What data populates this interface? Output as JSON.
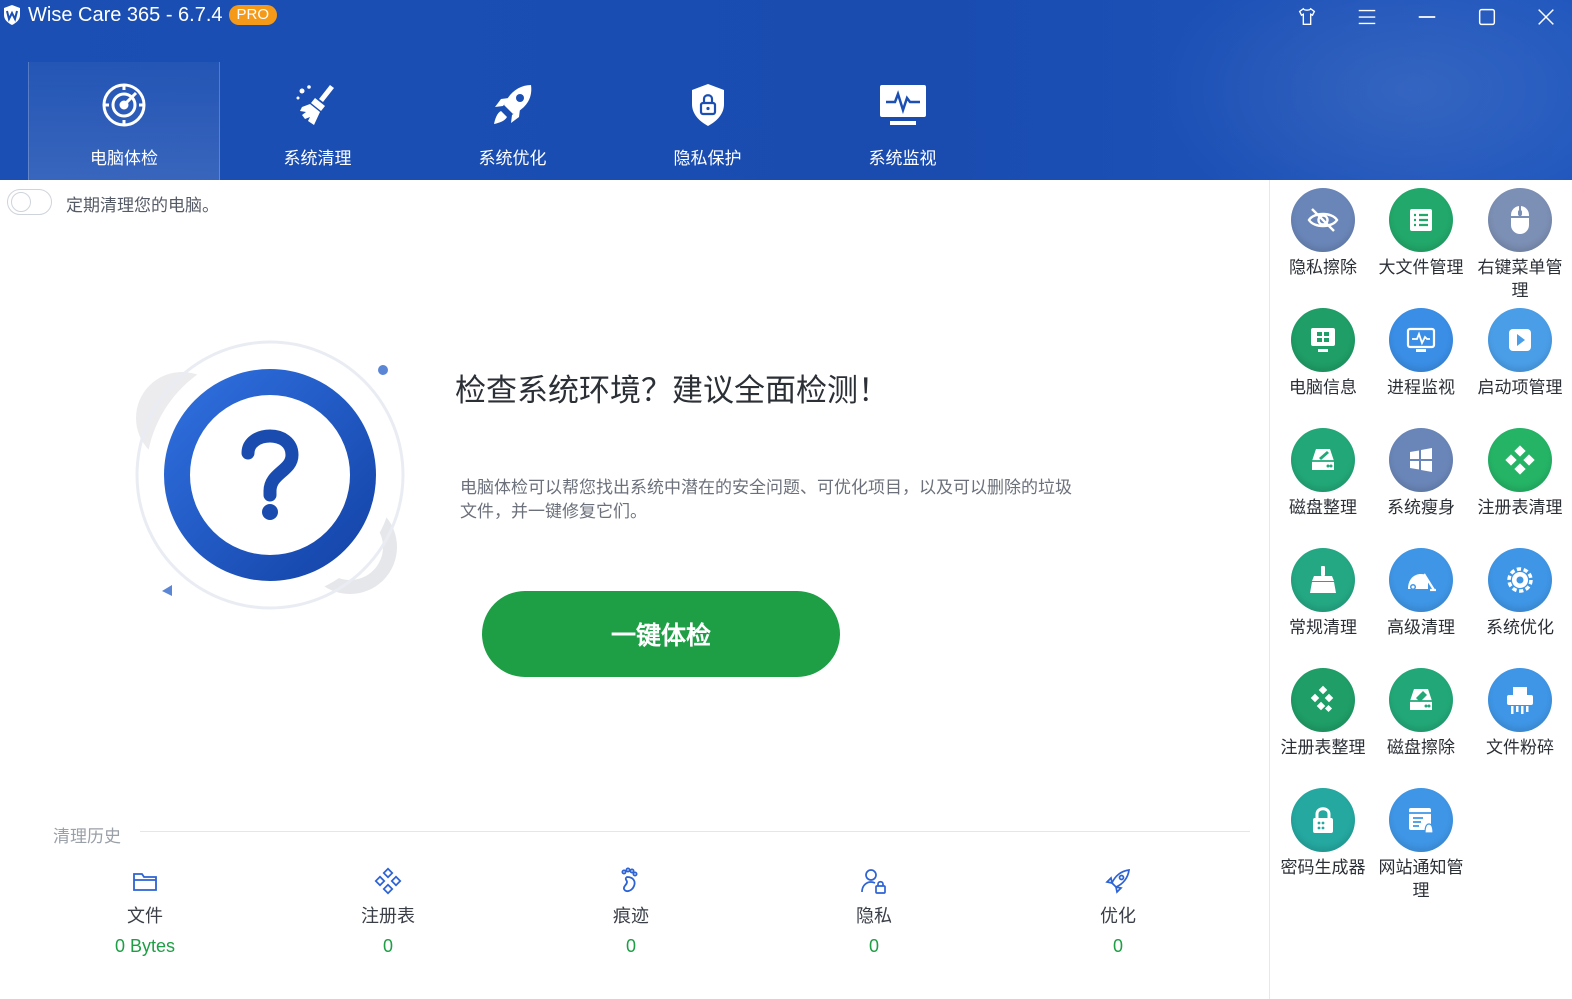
{
  "app": {
    "title": "Wise Care 365 - 6.7.4",
    "badge": "PRO"
  },
  "window_controls": [
    "skin-icon",
    "menu-icon",
    "minimize-icon",
    "maximize-icon",
    "close-icon"
  ],
  "nav": {
    "tabs": [
      {
        "label": "电脑体检",
        "icon": "radar-icon",
        "active": true
      },
      {
        "label": "系统清理",
        "icon": "broom-icon",
        "active": false
      },
      {
        "label": "系统优化",
        "icon": "rocket-icon",
        "active": false
      },
      {
        "label": "隐私保护",
        "icon": "shield-lock-icon",
        "active": false
      },
      {
        "label": "系统监视",
        "icon": "monitor-pulse-icon",
        "active": false
      }
    ]
  },
  "schedule": {
    "label": "定期清理您的电脑。",
    "enabled": false
  },
  "hero": {
    "headline": "检查系统环境？建议全面检测！",
    "description": "电脑体检可以帮您找出系统中潜在的安全问题、可优化项目，以及可以删除的垃圾文件，并一键修复它们。",
    "scan_button": "一键体检"
  },
  "history": {
    "label": "清理历史",
    "items": [
      {
        "label": "文件",
        "value": "0 Bytes",
        "icon": "folder-icon"
      },
      {
        "label": "注册表",
        "value": "0",
        "icon": "registry-icon"
      },
      {
        "label": "痕迹",
        "value": "0",
        "icon": "footprint-icon"
      },
      {
        "label": "隐私",
        "value": "0",
        "icon": "user-lock-icon"
      },
      {
        "label": "优化",
        "value": "0",
        "icon": "rocket-icon"
      }
    ]
  },
  "tools": [
    {
      "label": "隐私擦除",
      "icon": "eye-off-icon",
      "color": "#6a86b8"
    },
    {
      "label": "大文件管理",
      "icon": "file-list-icon",
      "color": "#22a86a"
    },
    {
      "label": "右键菜单管理",
      "icon": "mouse-icon",
      "color": "#7c8fb4"
    },
    {
      "label": "电脑信息",
      "icon": "pc-info-icon",
      "color": "#1f9e67"
    },
    {
      "label": "进程监视",
      "icon": "process-monitor-icon",
      "color": "#3a8ee6"
    },
    {
      "label": "启动项管理",
      "icon": "play-icon",
      "color": "#4a9ee8"
    },
    {
      "label": "磁盘整理",
      "icon": "disk-defrag-icon",
      "color": "#22a878"
    },
    {
      "label": "系统瘦身",
      "icon": "windows-icon",
      "color": "#6a86b8"
    },
    {
      "label": "注册表清理",
      "icon": "registry-clean-icon",
      "color": "#25b466"
    },
    {
      "label": "常规清理",
      "icon": "broom-icon",
      "color": "#24a884"
    },
    {
      "label": "高级清理",
      "icon": "vacuum-icon",
      "color": "#3f96e6"
    },
    {
      "label": "系统优化",
      "icon": "gear-icon",
      "color": "#3f96e6"
    },
    {
      "label": "注册表整理",
      "icon": "registry-defrag-icon",
      "color": "#1f9e67"
    },
    {
      "label": "磁盘擦除",
      "icon": "disk-erase-icon",
      "color": "#22a878"
    },
    {
      "label": "文件粉碎",
      "icon": "shredder-icon",
      "color": "#3f96e6"
    },
    {
      "label": "密码生成器",
      "icon": "password-lock-icon",
      "color": "#24a8a0"
    },
    {
      "label": "网站通知管理",
      "icon": "web-notify-icon",
      "color": "#3f96e6"
    }
  ]
}
